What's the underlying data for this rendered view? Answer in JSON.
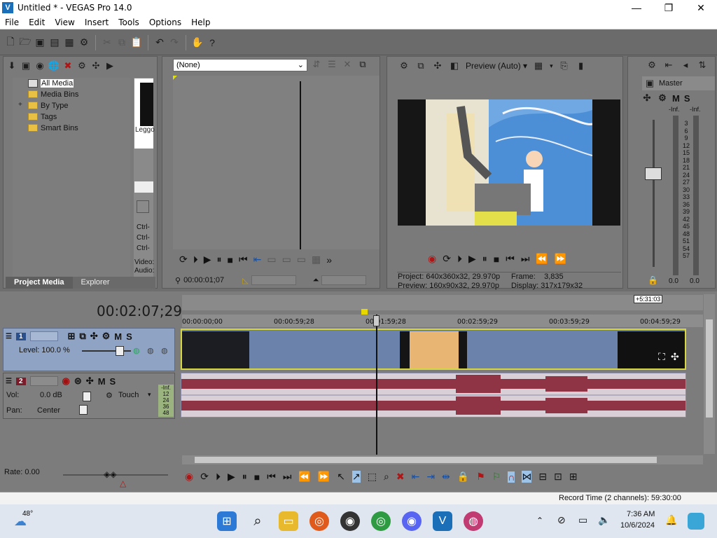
{
  "window": {
    "title": "Untitled * - VEGAS Pro 14.0",
    "logo": "V",
    "min": "—",
    "max": "❐",
    "close": "✕"
  },
  "menu": [
    "File",
    "Edit",
    "View",
    "Insert",
    "Tools",
    "Options",
    "Help"
  ],
  "media": {
    "tree": [
      "All Media",
      "Media Bins",
      "By Type",
      "Tags",
      "Smart Bins"
    ],
    "expander": "+",
    "thumb_label": "Leggo",
    "ctrl_labels": [
      "Ctrl-",
      "Ctrl-",
      "Ctrl-"
    ],
    "side_labels": [
      "Video:",
      "Audio:"
    ],
    "tabs": [
      "Project Media",
      "Explorer"
    ]
  },
  "trimmer": {
    "dropdown": "(None)",
    "timecode": "00:00:01;07"
  },
  "preview": {
    "mode": "Preview (Auto)",
    "project_label": "Project:",
    "project_value": "640x360x32, 29.970p",
    "preview_label": "Preview:",
    "preview_value": "160x90x32, 29.970p",
    "frame_label": "Frame:",
    "frame_value": "3,835",
    "display_label": "Display:",
    "display_value": "317x179x32"
  },
  "mixer": {
    "title": "Master",
    "m": "M",
    "s": "S",
    "inf_l": "-Inf.",
    "inf_r": "-Inf.",
    "scale": [
      "3",
      "6",
      "9",
      "12",
      "15",
      "18",
      "21",
      "24",
      "27",
      "30",
      "33",
      "36",
      "39",
      "42",
      "45",
      "48",
      "51",
      "54",
      "57"
    ],
    "val_l": "0.0",
    "val_r": "0.0"
  },
  "timeline": {
    "timecode": "00:02:07;29",
    "end_marker": "+5:31:03",
    "ruler": [
      "00:00:00;00",
      "00:00:59;28",
      "00:01:59;28",
      "00:02:59;29",
      "00:03:59;29",
      "00:04:59;29"
    ],
    "video_track": {
      "number": "1",
      "level": "Level: 100.0 %",
      "m": "M",
      "s": "S"
    },
    "audio_track": {
      "number": "2",
      "vol_label": "Vol:",
      "vol_value": "0.0 dB",
      "pan_label": "Pan:",
      "pan_value": "Center",
      "mode": "Touch",
      "m": "M",
      "s": "S",
      "meter": [
        "-Inf.",
        "12",
        "24",
        "36",
        "48"
      ]
    },
    "rate": "Rate: 0.00"
  },
  "status": {
    "record_time": "Record Time (2 channels): 59:30:00"
  },
  "taskbar": {
    "temp": "48°",
    "time": "7:36 AM",
    "date": "10/6/2024"
  }
}
